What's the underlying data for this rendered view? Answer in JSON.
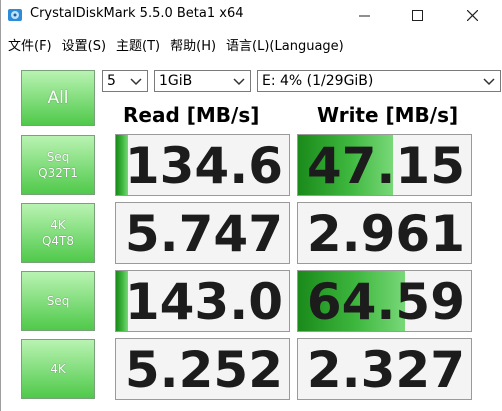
{
  "window": {
    "title": "CrystalDiskMark 5.5.0 Beta1 x64",
    "minimize_glyph": "—",
    "maximize_glyph": "☐",
    "close_glyph": "✕"
  },
  "menu": {
    "items": [
      {
        "label": "文件(F)"
      },
      {
        "label": "设置(S)"
      },
      {
        "label": "主题(T)"
      },
      {
        "label": "帮助(H)"
      },
      {
        "label": "语言(L)(Language)"
      }
    ]
  },
  "controls": {
    "all_label": "All",
    "test_count": "5",
    "test_size": "1GiB",
    "drive": "E: 4% (1/29GiB)"
  },
  "headers": {
    "read": "Read [MB/s]",
    "write": "Write [MB/s]"
  },
  "rows": [
    {
      "label_line1": "Seq",
      "label_line2": "Q32T1",
      "read": "134.6",
      "write": "47.15",
      "read_fraction": 0.07,
      "write_fraction": 0.55
    },
    {
      "label_line1": "4K",
      "label_line2": "Q4T8",
      "read": "5.747",
      "write": "2.961",
      "read_fraction": 0.0,
      "write_fraction": 0.0
    },
    {
      "label_line1": "Seq",
      "label_line2": "",
      "read": "143.0",
      "write": "64.59",
      "read_fraction": 0.07,
      "write_fraction": 0.62
    },
    {
      "label_line1": "4K",
      "label_line2": "",
      "read": "5.252",
      "write": "2.327",
      "read_fraction": 0.0,
      "write_fraction": 0.0
    }
  ],
  "colors": {
    "accent_green": "#3fb83f",
    "button_green_light": "#b9f3b2",
    "button_green_dark": "#4fc94a"
  }
}
